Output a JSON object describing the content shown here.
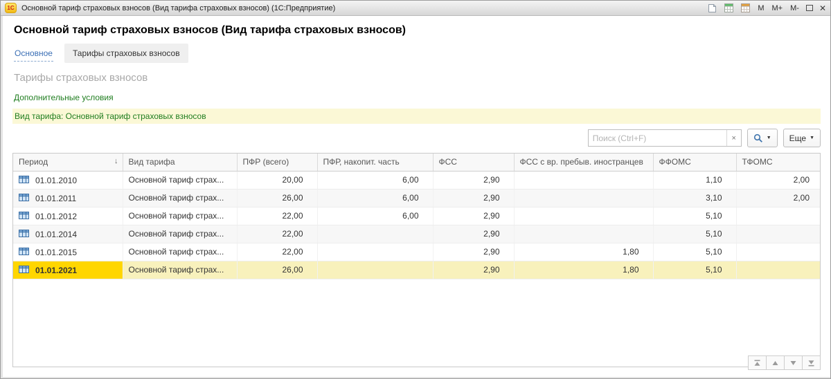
{
  "window": {
    "logo_text": "1С",
    "title": "Основной тариф страховых взносов (Вид тарифа страховых взносов)  (1С:Предприятие)",
    "buttons": {
      "m": "M",
      "m_plus": "M+",
      "m_minus": "M-",
      "close": "✕"
    }
  },
  "page": {
    "title": "Основной тариф страховых взносов (Вид тарифа страховых взносов)",
    "tab_main": "Основное",
    "tab_tariffs": "Тарифы страховых взносов",
    "section_title": "Тарифы страховых взносов",
    "conditions_link": "Дополнительные условия",
    "filter_bar": "Вид тарифа: Основной тариф страховых взносов"
  },
  "toolbar": {
    "search_placeholder": "Поиск (Ctrl+F)",
    "clear_label": "×",
    "search_icon": "magnifier-icon",
    "more_label": "Еще",
    "caret": "▼"
  },
  "table": {
    "headers": [
      "Период",
      "Вид тарифа",
      "ПФР (всего)",
      "ПФР, накопит. часть",
      "ФСС",
      "ФСС с вр. пребыв. иностранцев",
      "ФФОМС",
      "ТФОМС"
    ],
    "sort_column": "Период",
    "sort_icon": "↓",
    "row_icon": "record-icon",
    "rows": [
      {
        "period": "01.01.2010",
        "tariff": "Основной тариф страх...",
        "values": [
          "20,00",
          "6,00",
          "2,90",
          "",
          "1,10",
          "2,00"
        ],
        "selected": false
      },
      {
        "period": "01.01.2011",
        "tariff": "Основной тариф страх...",
        "values": [
          "26,00",
          "6,00",
          "2,90",
          "",
          "3,10",
          "2,00"
        ],
        "selected": false
      },
      {
        "period": "01.01.2012",
        "tariff": "Основной тариф страх...",
        "values": [
          "22,00",
          "6,00",
          "2,90",
          "",
          "5,10",
          ""
        ],
        "selected": false
      },
      {
        "period": "01.01.2014",
        "tariff": "Основной тариф страх...",
        "values": [
          "22,00",
          "",
          "2,90",
          "",
          "5,10",
          ""
        ],
        "selected": false
      },
      {
        "period": "01.01.2015",
        "tariff": "Основной тариф страх...",
        "values": [
          "22,00",
          "",
          "2,90",
          "1,80",
          "5,10",
          ""
        ],
        "selected": false
      },
      {
        "period": "01.01.2021",
        "tariff": "Основной тариф страх...",
        "values": [
          "26,00",
          "",
          "2,90",
          "1,80",
          "5,10",
          ""
        ],
        "selected": true
      }
    ]
  },
  "titlebar_icons": [
    "document-icon",
    "table-icon",
    "calendar-icon"
  ],
  "bottom_nav_icons": [
    "go-first-icon",
    "page-up-icon",
    "page-down-icon",
    "go-last-icon"
  ],
  "colors": {
    "selected_cell_bg": "#ffd600",
    "selected_row_bg": "#f8f1bc",
    "filter_bar_bg": "#fbf8d6",
    "accent_green": "#1f7d1f",
    "link_blue": "#3b6fb5",
    "logo_yellow": "#f3b915",
    "logo_red": "#cc1f1f"
  }
}
